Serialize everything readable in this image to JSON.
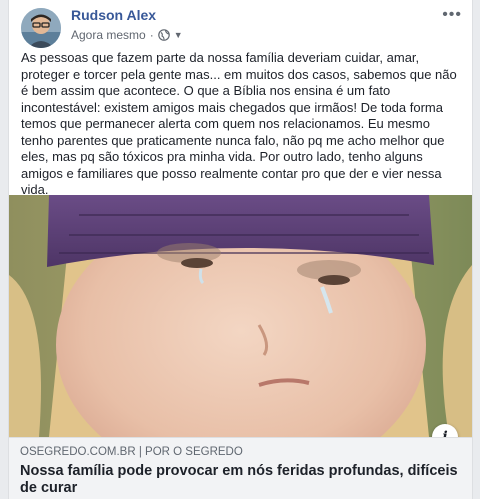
{
  "post": {
    "author": "Rudson Alex",
    "timestamp": "Agora mesmo",
    "separator": "·",
    "privacy_icon": "globe-icon",
    "more_label": "•••",
    "text": "As pessoas que fazem parte da nossa família deveriam cuidar, amar, proteger e torcer pela gente mas... em muitos dos casos, sabemos que não é bem assim que acontece. O que a Bíblia nos ensina é um fato incontestável: existem amigos mais chegados que irmãos! De toda forma temos que permanecer alerta com quem nos relacionamos. Eu mesmo tenho parentes que praticamente nunca falo, não pq me acho melhor que eles, mas pq são tóxicos pra minha vida. Por outro lado, tenho alguns amigos e familiares que posso realmente contar pro que der e vier nessa vida."
  },
  "link": {
    "source": "OSEGREDO.COM.BR | POR O SEGREDO",
    "headline": "Nossa família pode provocar em nós feridas profundas, difíceis de curar",
    "info_label": "i"
  },
  "colors": {
    "author": "#385898",
    "text": "#1d2129",
    "meta": "#616770",
    "link_bg": "#f2f3f5"
  }
}
